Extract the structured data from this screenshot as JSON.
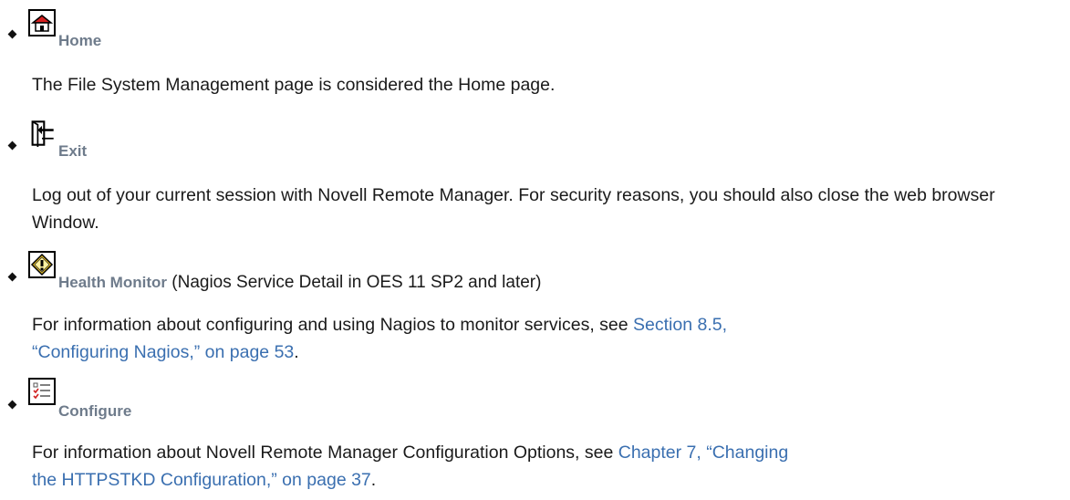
{
  "items": [
    {
      "icon": "home-icon",
      "term": "Home",
      "suffix": "",
      "description": "The File System Management page is considered the Home page."
    },
    {
      "icon": "exit-door-icon",
      "term": "Exit",
      "suffix": "",
      "description": "Log out of your current session with Novell Remote Manager. For security reasons, you should also close the web browser Window."
    },
    {
      "icon": "health-monitor-icon",
      "term": "Health Monitor",
      "suffix": " (Nagios Service Detail in OES 11 SP2 and later)",
      "description_before": "For information about configuring and using Nagios to monitor services, see ",
      "link_line1": "Section 8.5,",
      "link_line2": "“Configuring Nagios,” on page 53",
      "description_after": "."
    },
    {
      "icon": "configure-checklist-icon",
      "term": "Configure",
      "suffix": "",
      "description_before": "For information about Novell Remote Manager Configuration Options, see ",
      "link_line1": "Chapter 7, “Changing",
      "link_line2": "the HTTPSTKD Configuration,” on page 37",
      "description_after": "."
    }
  ]
}
